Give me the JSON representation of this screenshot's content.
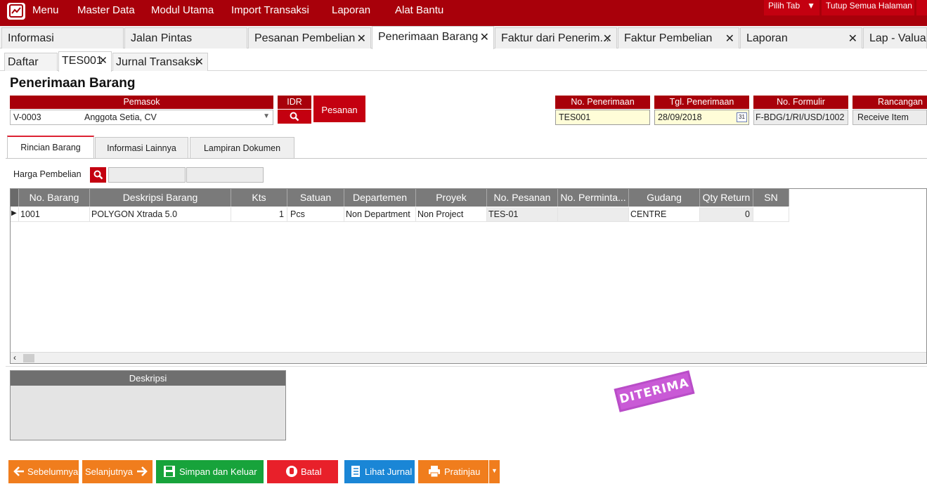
{
  "menubar": {
    "items": [
      "Menu",
      "Master Data",
      "Modul Utama",
      "Import Transaksi",
      "Laporan",
      "Alat Bantu"
    ],
    "pilih_tab": "Pilih Tab",
    "tutup_semua": "Tutup Semua Halaman"
  },
  "main_tabs": [
    {
      "label": "Informasi"
    },
    {
      "label": "Jalan Pintas"
    },
    {
      "label": "Pesanan Pembelian"
    },
    {
      "label": "Penerimaan Barang"
    },
    {
      "label": "Faktur dari Penerim..."
    },
    {
      "label": "Faktur Pembelian"
    },
    {
      "label": "Laporan"
    },
    {
      "label": "Lap - Valuas"
    }
  ],
  "sub_tabs": [
    {
      "label": "Daftar"
    },
    {
      "label": "TES001"
    },
    {
      "label": "Jurnal Transaksi"
    }
  ],
  "page_title": "Penerimaan Barang",
  "header": {
    "pemasok_label": "Pemasok",
    "pemasok_code": "V-0003",
    "pemasok_name": "Anggota Setia, CV",
    "currency_label": "IDR",
    "pesanan_button": "Pesanan",
    "no_penerimaan_label": "No. Penerimaan",
    "no_penerimaan": "TES001",
    "tgl_penerimaan_label": "Tgl. Penerimaan",
    "tgl_penerimaan": "28/09/2018",
    "calendar_day": "31",
    "no_formulir_label": "No. Formulir",
    "no_formulir": "F-BDG/1/RI/USD/1002",
    "rancangan_label": "Rancangan",
    "rancangan": "Receive Item"
  },
  "form_tabs": [
    "Rincian Barang",
    "Informasi Lainnya",
    "Lampiran Dokumen"
  ],
  "harga_pembelian_label": "Harga Pembelian",
  "grid": {
    "columns": [
      "No. Barang",
      "Deskripsi Barang",
      "Kts",
      "Satuan",
      "Departemen",
      "Proyek",
      "No. Pesanan",
      "No. Perminta...",
      "Gudang",
      "Qty Return",
      "SN"
    ],
    "rows": [
      [
        "1001",
        "POLYGON Xtrada 5.0",
        "1",
        "Pcs",
        "Non Department",
        "Non Project",
        "TES-01",
        "",
        "CENTRE",
        "0",
        ""
      ]
    ]
  },
  "deskripsi_label": "Deskripsi",
  "stamp": "DITERIMA",
  "buttons": {
    "sebelumnya": "Sebelumnya",
    "selanjutnya": "Selanjutnya",
    "simpan": "Simpan dan Keluar",
    "batal": "Batal",
    "lihat_jurnal": "Lihat Jurnal",
    "pratinjau": "Pratinjau"
  },
  "colors": {
    "brand_red": "#a8000a",
    "orange": "#f07d1d",
    "green": "#17a33b",
    "red": "#e8202a",
    "blue": "#1a86d6",
    "stamp": "#c95ad6"
  }
}
